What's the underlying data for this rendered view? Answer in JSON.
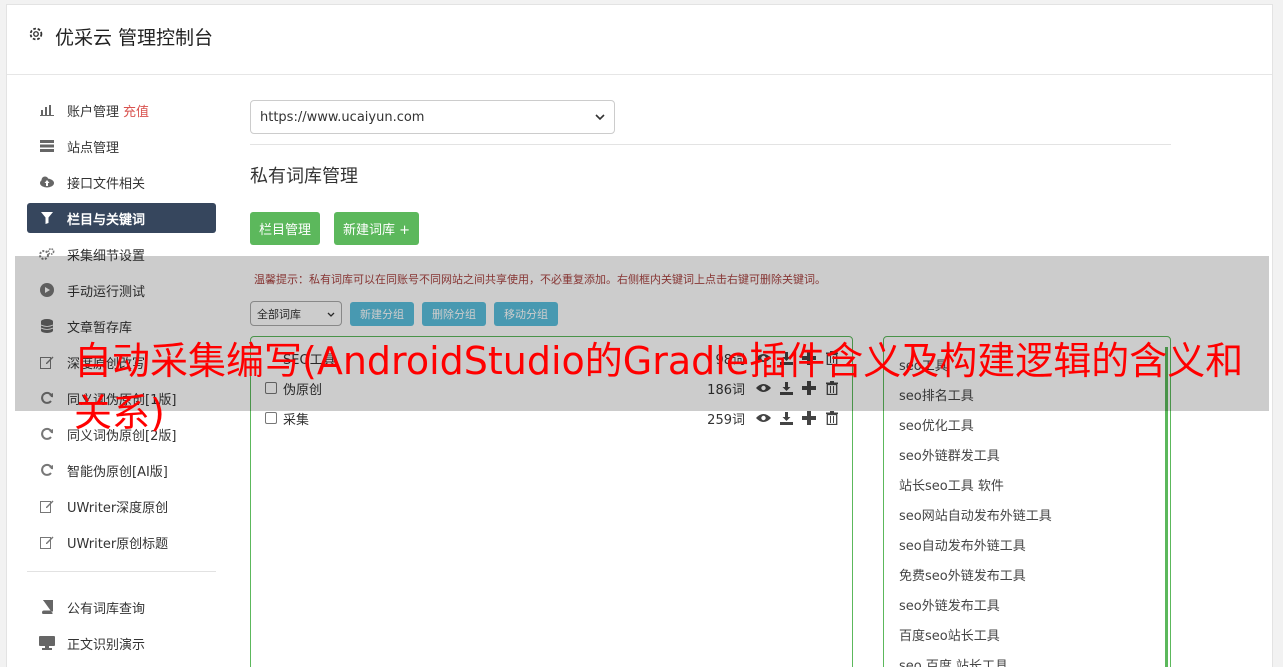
{
  "header": {
    "title": "优采云 管理控制台",
    "icon": "gear-icon"
  },
  "sidebar": {
    "items": [
      {
        "label": "账户管理",
        "badge": "充值",
        "icon": "bar-chart-icon"
      },
      {
        "label": "站点管理",
        "icon": "server-icon"
      },
      {
        "label": "接口文件相关",
        "icon": "cloud-upload-icon"
      },
      {
        "label": "栏目与关键词",
        "icon": "filter-icon"
      },
      {
        "label": "采集细节设置",
        "icon": "cogs-icon"
      },
      {
        "label": "手动运行测试",
        "icon": "play-circle-icon"
      },
      {
        "label": "文章暂存库",
        "icon": "database-icon"
      },
      {
        "label": "深度原创改写",
        "icon": "edit-icon"
      },
      {
        "label": "同义词伪原创[1版]",
        "icon": "refresh-icon"
      },
      {
        "label": "同义词伪原创[2版]",
        "icon": "refresh-icon"
      },
      {
        "label": "智能伪原创[AI版]",
        "icon": "refresh-icon"
      },
      {
        "label": "UWriter深度原创",
        "icon": "edit-icon"
      },
      {
        "label": "UWriter原创标题",
        "icon": "edit-icon"
      },
      {
        "label": "公有词库查询",
        "icon": "book-icon"
      },
      {
        "label": "正文识别演示",
        "icon": "monitor-icon"
      }
    ]
  },
  "main": {
    "site_select": "https://www.ucaiyun.com",
    "page_title": "私有词库管理",
    "buttons": {
      "column_manage": "栏目管理",
      "new_library": "新建词库 +"
    },
    "tip": "温馨提示：私有词库可以在同账号不同网站之间共享使用，不必重复添加。右侧框内关键词上点击右键可删除关键词。",
    "filter_select": "全部词库",
    "group_buttons": {
      "new_group": "新建分组",
      "delete_group": "删除分组",
      "move_group": "移动分组"
    },
    "groups": [
      {
        "name": "SEO工具",
        "count": "98词",
        "checkbox": false
      },
      {
        "name": "伪原创",
        "count": "186词",
        "checkbox": true
      },
      {
        "name": "采集",
        "count": "259词",
        "checkbox": true
      }
    ],
    "keywords": [
      "seo工具",
      "seo排名工具",
      "seo优化工具",
      "seo外链群发工具",
      "站长seo工具 软件",
      "seo网站自动发布外链工具",
      "seo自动发布外链工具",
      "免费seo外链发布工具",
      "seo外链发布工具",
      "百度seo站长工具",
      "seo 百度 站长工具"
    ]
  },
  "overlay_title": "自动采集编写(AndroidStudio的Gradle插件含义及构建逻辑的含义和关系)",
  "colors": {
    "active_nav": "#36465d",
    "green": "#5cb85c",
    "blue": "#5bc0de",
    "overlay_text": "#ff0000"
  }
}
